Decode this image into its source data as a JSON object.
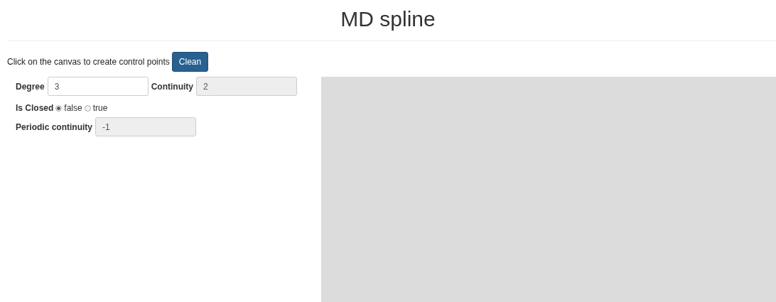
{
  "title": "MD spline",
  "instruction": "Click on the canvas to create control points",
  "clean_button": "Clean",
  "fields": [
    {
      "label": "Degree",
      "value": "3",
      "disabled": false
    },
    {
      "label": "Continuity",
      "value": "2",
      "disabled": true
    }
  ],
  "is_closed": {
    "label": "Is Closed",
    "options": [
      {
        "label": "false",
        "selected": true
      },
      {
        "label": "true",
        "selected": false
      }
    ]
  },
  "periodic_continuity": {
    "label": "Periodic continuity",
    "value": "-1",
    "disabled": true
  }
}
